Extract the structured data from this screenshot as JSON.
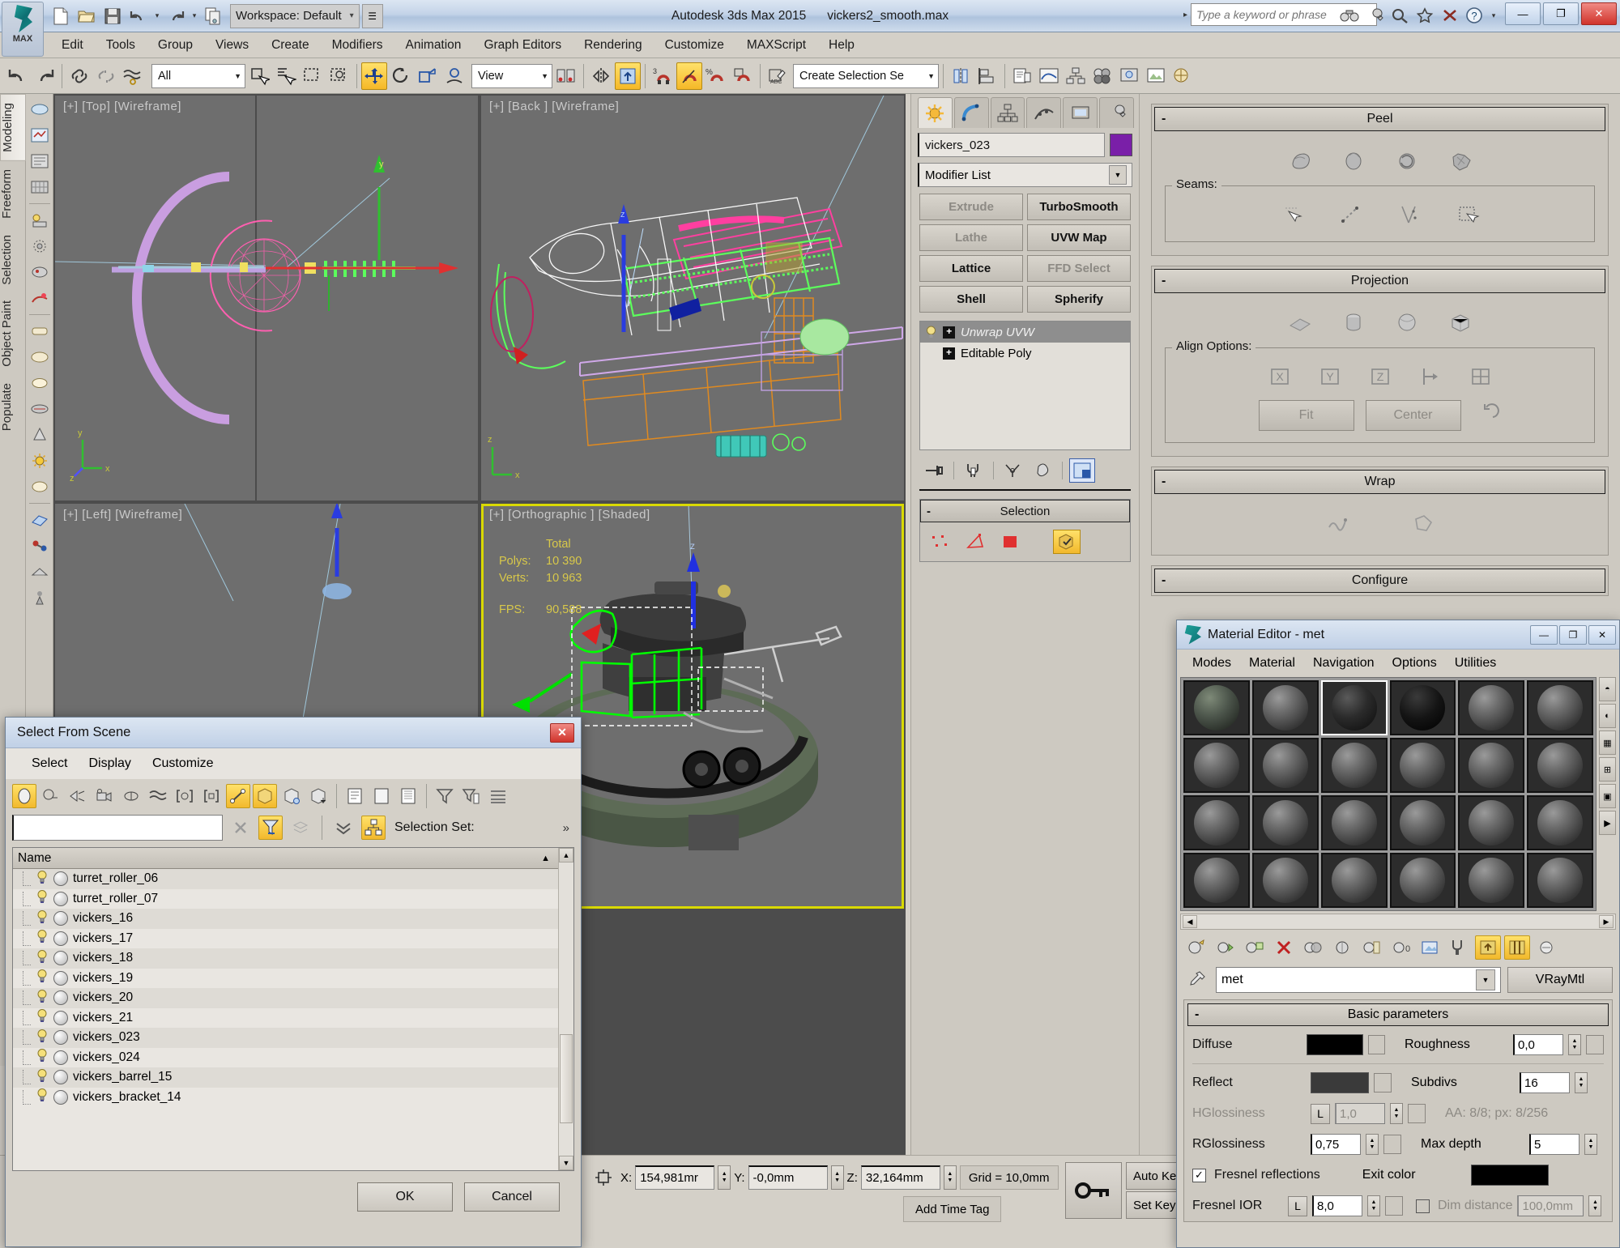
{
  "app": {
    "title": "Autodesk 3ds Max  2015",
    "file": "vickers2_smooth.max",
    "logo_label": "MAX",
    "workspace": "Workspace: Default",
    "search_placeholder": "Type a keyword or phrase"
  },
  "menu": [
    "Edit",
    "Tools",
    "Group",
    "Views",
    "Create",
    "Modifiers",
    "Animation",
    "Graph Editors",
    "Rendering",
    "Customize",
    "MAXScript",
    "Help"
  ],
  "toolbar": {
    "selection_filter": "All",
    "reference_coord": "View",
    "named_selection_set": "Create Selection Se"
  },
  "left_ribbon": {
    "tabs": [
      "Modeling",
      "Freeform",
      "Selection",
      "Object Paint",
      "Populate"
    ],
    "active": "Modeling"
  },
  "viewports": [
    {
      "label": "[+] [Top] [Wireframe]",
      "active": false
    },
    {
      "label": "[+] [Back ] [Wireframe]",
      "active": false
    },
    {
      "label": "[+] [Left] [Wireframe]",
      "active": false
    },
    {
      "label": "[+] [Orthographic ] [Shaded]",
      "active": true
    }
  ],
  "stats": {
    "header": "Total",
    "polys_label": "Polys:",
    "polys_value": "10 390",
    "verts_label": "Verts:",
    "verts_value": "10 963",
    "fps_label": "FPS:",
    "fps_value": "90,588"
  },
  "command_panel": {
    "object_name": "vickers_023",
    "object_color": "#7a1fa8",
    "modifier_list_label": "Modifier List",
    "quick_buttons": [
      {
        "label": "Extrude",
        "enabled": false
      },
      {
        "label": "TurboSmooth",
        "enabled": true
      },
      {
        "label": "Lathe",
        "enabled": false
      },
      {
        "label": "UVW Map",
        "enabled": true
      },
      {
        "label": "Lattice",
        "enabled": true
      },
      {
        "label": "FFD Select",
        "enabled": false
      },
      {
        "label": "Shell",
        "enabled": true
      },
      {
        "label": "Spherify",
        "enabled": true
      }
    ],
    "stack": [
      {
        "label": "Unwrap UVW",
        "selected": true
      },
      {
        "label": "Editable Poly",
        "selected": false
      }
    ],
    "selection_rollout": "Selection"
  },
  "right_panel": {
    "rollouts": [
      {
        "title": "Peel",
        "group_label": "Seams:"
      },
      {
        "title": "Projection",
        "group_label": "Align Options:",
        "buttons": [
          "Fit",
          "Center"
        ],
        "axes": [
          "X",
          "Y",
          "Z"
        ]
      },
      {
        "title": "Wrap"
      },
      {
        "title": "Configure"
      }
    ]
  },
  "select_from_scene": {
    "title": "Select From Scene",
    "menu": [
      "Select",
      "Display",
      "Customize"
    ],
    "search_value": "",
    "selection_set_label": "Selection Set:",
    "column_header": "Name",
    "items": [
      "turret_roller_06",
      "turret_roller_07",
      "vickers_16",
      "vickers_17",
      "vickers_18",
      "vickers_19",
      "vickers_20",
      "vickers_21",
      "vickers_023",
      "vickers_024",
      "vickers_barrel_15",
      "vickers_bracket_14"
    ],
    "ok_label": "OK",
    "cancel_label": "Cancel"
  },
  "material_editor": {
    "title": "Material Editor - met",
    "menu": [
      "Modes",
      "Material",
      "Navigation",
      "Options",
      "Utilities"
    ],
    "material_name": "met",
    "material_type": "VRayMtl",
    "rollout_title": "Basic parameters",
    "params": {
      "diffuse_label": "Diffuse",
      "diffuse_color": "#000000",
      "roughness_label": "Roughness",
      "roughness_value": "0,0",
      "reflect_label": "Reflect",
      "reflect_color": "#3a3a3a",
      "subdivs_label": "Subdivs",
      "subdivs_value": "16",
      "hglossiness_label": "HGlossiness",
      "hglossiness_value": "1,0",
      "aa_text": "AA: 8/8; px: 8/256",
      "rglossiness_label": "RGlossiness",
      "rglossiness_value": "0,75",
      "maxdepth_label": "Max depth",
      "maxdepth_value": "5",
      "fresnel_label": "Fresnel reflections",
      "fresnel_checked": true,
      "exitcolor_label": "Exit color",
      "exitcolor_value": "#000000",
      "fresnel_ior_label": "Fresnel IOR",
      "fresnel_ior_value": "8,0",
      "dim_distance_label": "Dim distance",
      "dim_distance_value": "100,0mm",
      "l_label": "L"
    }
  },
  "status_bar": {
    "x_label": "X:",
    "x_value": "154,981mr",
    "y_label": "Y:",
    "y_value": "-0,0mm",
    "z_label": "Z:",
    "z_value": "32,164mm",
    "grid_label": "Grid = 10,0mm",
    "add_time_tag": "Add Time Tag",
    "auto_key": "Auto Key",
    "set_key": "Set Key"
  }
}
